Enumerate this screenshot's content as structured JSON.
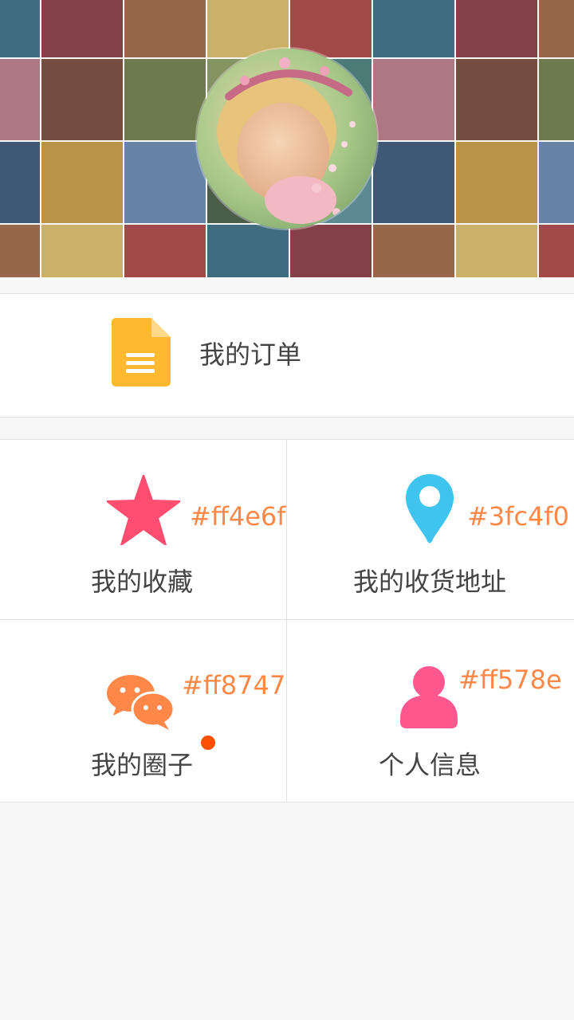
{
  "header": {
    "background": "colorful-tile-mosaic",
    "avatar": "profile-avatar-girl-blowing-flowers"
  },
  "order": {
    "label": "我的订单",
    "icon": "document-icon",
    "icon_color": "#ffb931"
  },
  "grid": {
    "favorites": {
      "label": "我的收藏",
      "hex": "#ff4e6f",
      "icon": "star-icon",
      "icon_color": "#ff4e6f"
    },
    "address": {
      "label": "我的收货地址",
      "hex": "#3fc4f0",
      "icon": "location-pin-icon",
      "icon_color": "#3fc4f0"
    },
    "circle": {
      "label": "我的圈子",
      "hex": "#ff8747",
      "icon": "chat-bubbles-icon",
      "icon_color": "#ff8747",
      "has_badge": true
    },
    "profile": {
      "label": "个人信息",
      "hex": "#ff578e",
      "icon": "user-icon",
      "icon_color": "#ff578e"
    }
  },
  "colors": {
    "hex_text": "#ff8747",
    "badge": "#ff5000"
  }
}
